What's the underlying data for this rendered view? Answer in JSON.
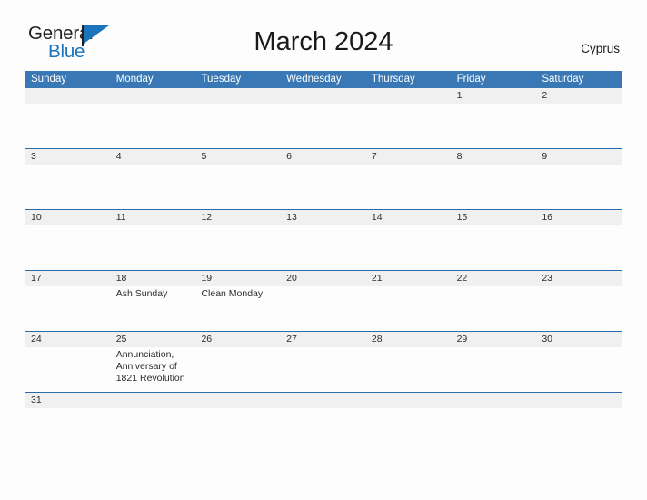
{
  "brand": {
    "name_part1": "General",
    "name_part2": "Blue",
    "flag_icon": "triangle-flag-icon"
  },
  "header": {
    "title": "March 2024",
    "region": "Cyprus"
  },
  "colors": {
    "header_blue": "#3a78b5",
    "row_divider_blue": "#2a6cab",
    "daynum_band_gray": "#f0f0f0",
    "brand_blue": "#1b75bc",
    "text_dark": "#2b2b2b",
    "page_background": "#fdfdfd"
  },
  "calendar": {
    "weekdays": [
      "Sunday",
      "Monday",
      "Tuesday",
      "Wednesday",
      "Thursday",
      "Friday",
      "Saturday"
    ],
    "weeks": [
      {
        "short": false,
        "days": [
          {
            "num": "",
            "events": []
          },
          {
            "num": "",
            "events": []
          },
          {
            "num": "",
            "events": []
          },
          {
            "num": "",
            "events": []
          },
          {
            "num": "",
            "events": []
          },
          {
            "num": "1",
            "events": []
          },
          {
            "num": "2",
            "events": []
          }
        ]
      },
      {
        "short": false,
        "days": [
          {
            "num": "3",
            "events": []
          },
          {
            "num": "4",
            "events": []
          },
          {
            "num": "5",
            "events": []
          },
          {
            "num": "6",
            "events": []
          },
          {
            "num": "7",
            "events": []
          },
          {
            "num": "8",
            "events": []
          },
          {
            "num": "9",
            "events": []
          }
        ]
      },
      {
        "short": false,
        "days": [
          {
            "num": "10",
            "events": []
          },
          {
            "num": "11",
            "events": []
          },
          {
            "num": "12",
            "events": []
          },
          {
            "num": "13",
            "events": []
          },
          {
            "num": "14",
            "events": []
          },
          {
            "num": "15",
            "events": []
          },
          {
            "num": "16",
            "events": []
          }
        ]
      },
      {
        "short": false,
        "days": [
          {
            "num": "17",
            "events": []
          },
          {
            "num": "18",
            "events": [
              "Ash Sunday"
            ]
          },
          {
            "num": "19",
            "events": [
              "Clean Monday"
            ]
          },
          {
            "num": "20",
            "events": []
          },
          {
            "num": "21",
            "events": []
          },
          {
            "num": "22",
            "events": []
          },
          {
            "num": "23",
            "events": []
          }
        ]
      },
      {
        "short": false,
        "days": [
          {
            "num": "24",
            "events": []
          },
          {
            "num": "25",
            "events": [
              "Annunciation, Anniversary of 1821 Revolution"
            ]
          },
          {
            "num": "26",
            "events": []
          },
          {
            "num": "27",
            "events": []
          },
          {
            "num": "28",
            "events": []
          },
          {
            "num": "29",
            "events": []
          },
          {
            "num": "30",
            "events": []
          }
        ]
      },
      {
        "short": true,
        "days": [
          {
            "num": "31",
            "events": []
          },
          {
            "num": "",
            "events": []
          },
          {
            "num": "",
            "events": []
          },
          {
            "num": "",
            "events": []
          },
          {
            "num": "",
            "events": []
          },
          {
            "num": "",
            "events": []
          },
          {
            "num": "",
            "events": []
          }
        ]
      }
    ]
  }
}
